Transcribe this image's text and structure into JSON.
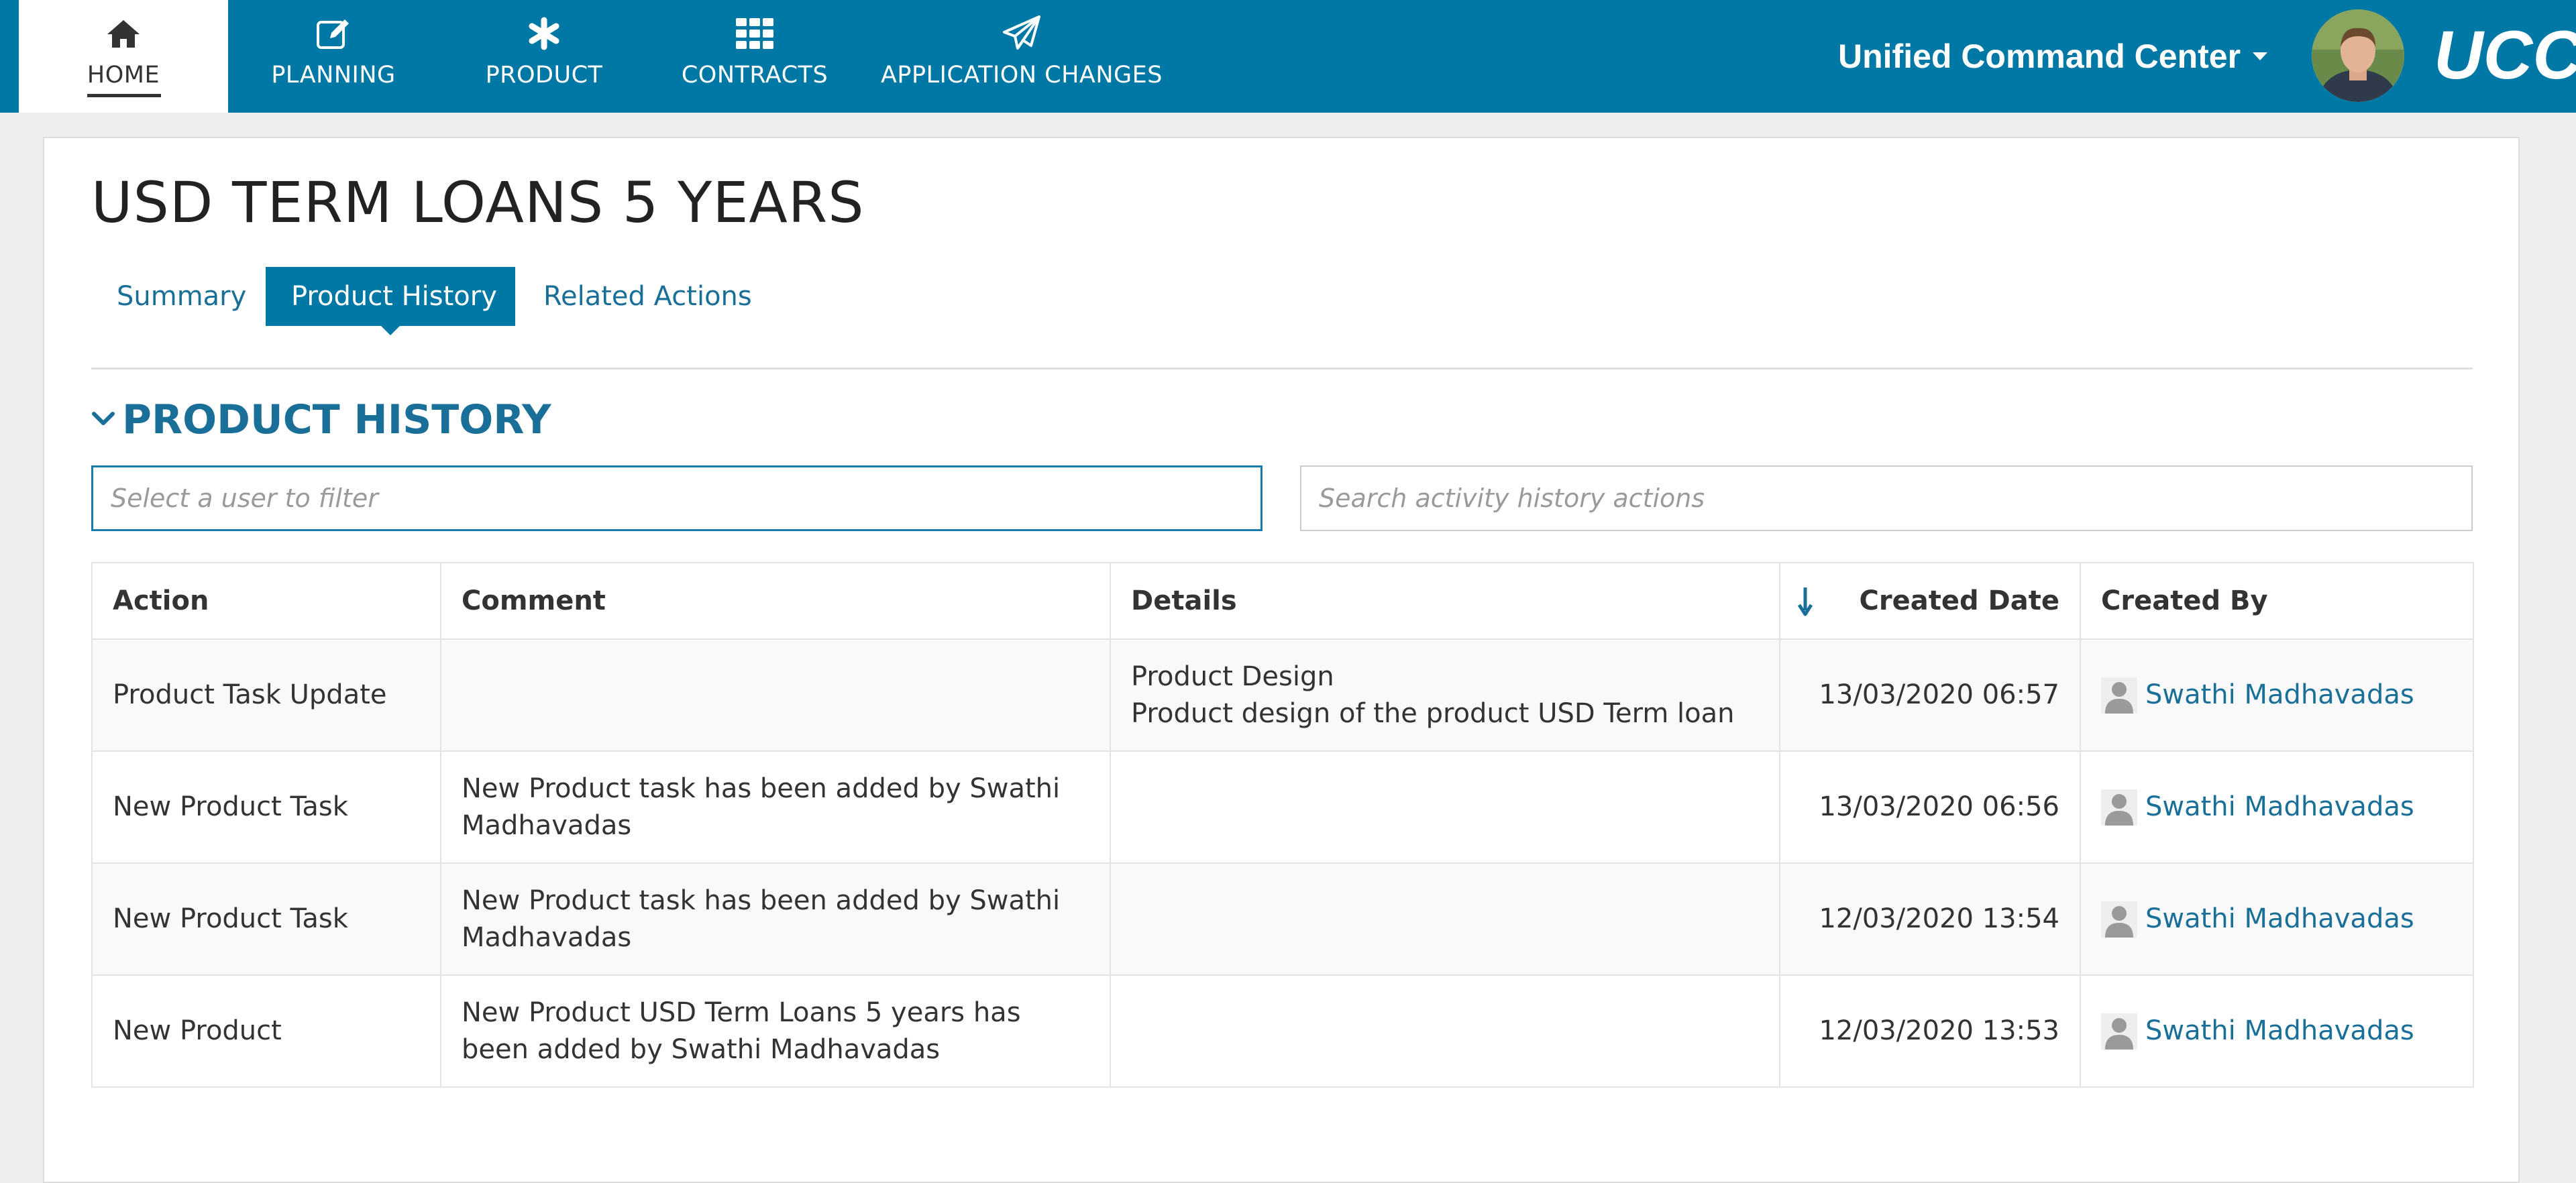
{
  "nav": {
    "items": [
      {
        "label": "HOME",
        "icon": "home-icon",
        "active": true
      },
      {
        "label": "PLANNING",
        "icon": "edit-icon",
        "active": false
      },
      {
        "label": "PRODUCT",
        "icon": "asterisk-icon",
        "active": false
      },
      {
        "label": "CONTRACTS",
        "icon": "grid-icon",
        "active": false
      },
      {
        "label": "APPLICATION CHANGES",
        "icon": "paper-plane-icon",
        "active": false
      }
    ],
    "app_name": "Unified Command Center",
    "brand": "UCC"
  },
  "page": {
    "title": "USD TERM LOANS 5 YEARS",
    "tabs": [
      {
        "label": "Summary",
        "active": false
      },
      {
        "label": "Product History",
        "active": true
      },
      {
        "label": "Related Actions",
        "active": false
      }
    ]
  },
  "history": {
    "heading": "PRODUCT HISTORY",
    "user_filter": {
      "placeholder": "Select a user to filter",
      "value": ""
    },
    "search": {
      "placeholder": "Search activity history actions",
      "value": ""
    },
    "columns": [
      "Action",
      "Comment",
      "Details",
      "Created Date",
      "Created By"
    ],
    "sort_column": "Created Date",
    "sort_direction": "descending",
    "rows": [
      {
        "action": "Product Task Update",
        "comment": "",
        "details": [
          "Product Design",
          "Product design of the product USD Term loan"
        ],
        "created_date": "13/03/2020 06:57",
        "created_by": "Swathi Madhavadas"
      },
      {
        "action": "New Product Task",
        "comment": "New Product task has been added by Swathi Madhavadas",
        "details": [],
        "created_date": "13/03/2020 06:56",
        "created_by": "Swathi Madhavadas"
      },
      {
        "action": "New Product Task",
        "comment": "New Product task has been added by Swathi Madhavadas",
        "details": [],
        "created_date": "12/03/2020 13:54",
        "created_by": "Swathi Madhavadas"
      },
      {
        "action": "New Product",
        "comment": "New Product USD Term Loans 5 years has been added by Swathi Madhavadas",
        "details": [],
        "created_date": "12/03/2020 13:53",
        "created_by": "Swathi Madhavadas"
      }
    ]
  },
  "colors": {
    "primary": "#0078a6",
    "link": "#1a6f99",
    "row_alt": "#f9f9f9",
    "border": "#e3e3e3"
  }
}
